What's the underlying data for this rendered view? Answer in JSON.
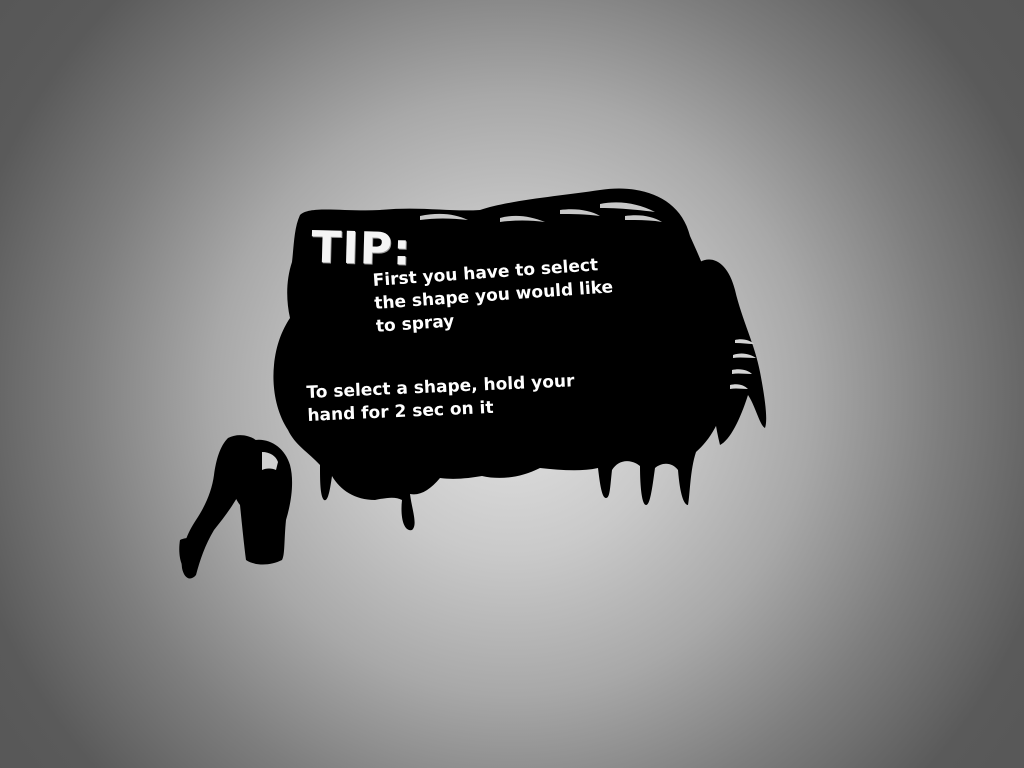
{
  "tip": {
    "title": "TIP:",
    "paragraph1": {
      "lines": [
        "First you have to select",
        "the shape you would like",
        "to spray"
      ]
    },
    "paragraph2": {
      "lines": [
        "To select a shape, hold your",
        "hand for 2 sec on it"
      ]
    }
  },
  "colors": {
    "splat": "#000000",
    "text": "#ffffff",
    "background_center": "#e4e4e4",
    "background_edge": "#555555"
  },
  "icons": {
    "hand": "spray-can-hand-icon",
    "splat": "paint-splat-icon"
  }
}
